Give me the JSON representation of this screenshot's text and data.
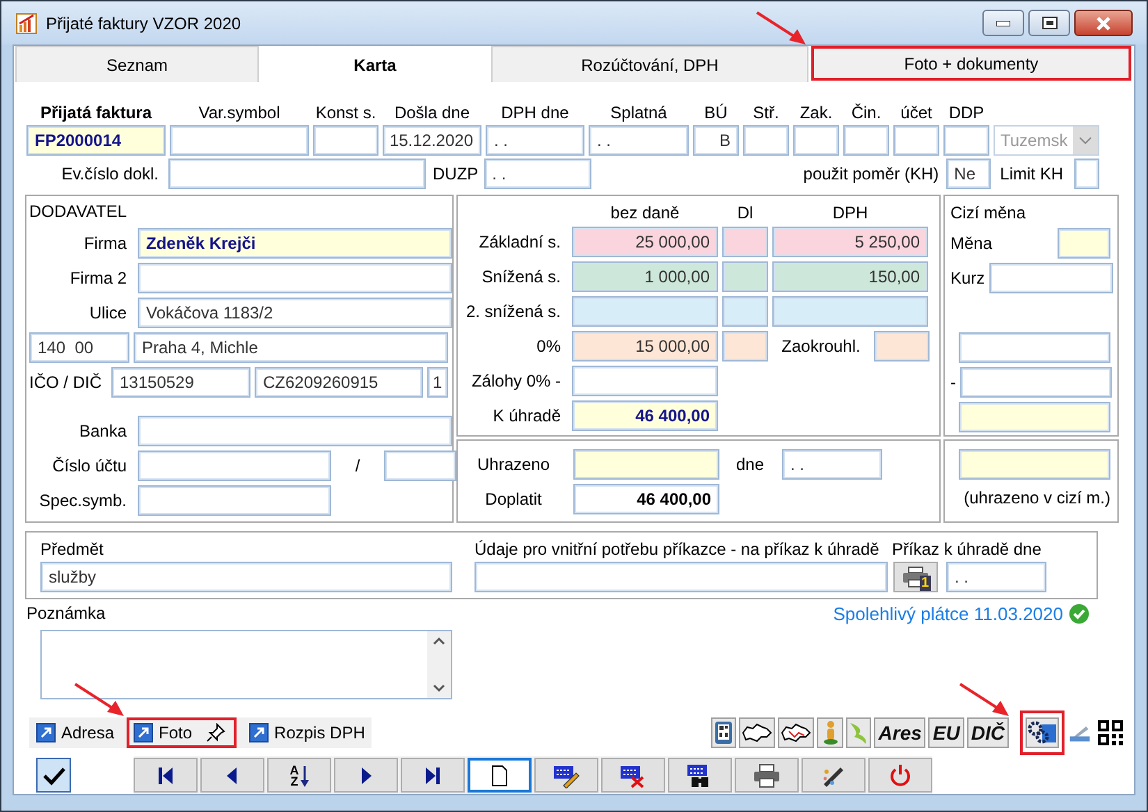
{
  "window": {
    "title": "Přijaté faktury VZOR 2020"
  },
  "tabs": [
    {
      "label": "Seznam",
      "selected": false,
      "highlighted": false
    },
    {
      "label": "Karta",
      "selected": true,
      "highlighted": false
    },
    {
      "label": "Rozúčtování, DPH",
      "selected": false,
      "highlighted": false
    },
    {
      "label": "Foto + dokumenty",
      "selected": false,
      "highlighted": true
    }
  ],
  "invoice": {
    "label": "Přijatá faktura",
    "number": "FP2000014"
  },
  "header_fields": [
    {
      "label": "Var.symbol"
    },
    {
      "label": "Konst s."
    },
    {
      "label": "Došla dne",
      "value": "15.12.2020"
    },
    {
      "label": "DPH dne",
      "value": ". ."
    },
    {
      "label": "Splatná",
      "value": ". ."
    },
    {
      "label": "BÚ",
      "value": "B"
    },
    {
      "label": "Stř."
    },
    {
      "label": "Zak."
    },
    {
      "label": "Čin."
    },
    {
      "label": "účet"
    },
    {
      "label": "DDP"
    }
  ],
  "type_select": {
    "value": "Tuzemsk",
    "disabled": true
  },
  "document_number": {
    "label": "Ev.číslo dokl."
  },
  "duzp": {
    "label": "DUZP",
    "value": ". ."
  },
  "kh_ratio": {
    "label": "použit poměr (KH)",
    "value": "Ne"
  },
  "limit_kh": {
    "label": "Limit KH"
  },
  "supplier": {
    "title": "DODAVATEL",
    "company": {
      "label": "Firma",
      "value": "Zdeněk Krejči"
    },
    "company_2": {
      "label": "Firma 2"
    },
    "street": {
      "label": "Ulice",
      "value": "Vokáčova 1183/2"
    },
    "zip": "140  00",
    "city": "Praha 4, Michle",
    "ids": {
      "label": "IČO / DIČ",
      "ico": "13150529",
      "dic": "CZ6209260915",
      "suffix": "1"
    },
    "bank": {
      "label": "Banka"
    },
    "account": {
      "label": "Číslo účtu",
      "separator": "/"
    },
    "spec_symbol": {
      "label": "Spec.symb."
    }
  },
  "amounts": {
    "columns": [
      "bez daně",
      "Dl",
      "DPH"
    ],
    "rows": [
      {
        "kind": "rate",
        "label": "Základní s.",
        "base": "25 000,00",
        "vat": "5 250,00",
        "color": "#fad5de"
      },
      {
        "kind": "rate",
        "label": "Snížená s.",
        "base": "1 000,00",
        "vat": "150,00",
        "color": "#cde7da"
      },
      {
        "kind": "rate",
        "label": "2. snížená s.",
        "color": "#d7edf8"
      },
      {
        "kind": "rounding",
        "label": "0%",
        "base": "15 000,00",
        "rounding_label": "Zaokrouhl.",
        "color": "#fde6d6"
      },
      {
        "kind": "advance",
        "label": "Zálohy 0% -"
      },
      {
        "kind": "total",
        "label": "K úhradě",
        "base": "46 400,00"
      }
    ]
  },
  "payment": {
    "paid_label": "Uhrazeno",
    "date_label": "dne",
    "date": ". .",
    "remaining_label": "Doplatit",
    "remaining": "46 400,00"
  },
  "foreign_currency": {
    "title": "Cizí měna",
    "currency_label": "Měna",
    "rate_label": "Kurz",
    "advance_sign": "-",
    "paid_note": "(uhrazeno v cizí m.)"
  },
  "subject": {
    "label": "Předmět",
    "value": "služby"
  },
  "internal": {
    "label": "Údaje pro vnitřní potřebu příkazce - na příkaz k úhradě"
  },
  "payment_order": {
    "label": "Příkaz k úhradě dne",
    "value": ". .",
    "print_badge": "1"
  },
  "note": {
    "label": "Poznámka"
  },
  "reliable_payer": {
    "text": "Spolehlivý plátce 11.03.2020",
    "verified": true
  },
  "links": [
    {
      "label": "Adresa",
      "pinned": false,
      "highlighted": false
    },
    {
      "label": "Foto",
      "pinned": true,
      "highlighted": true
    },
    {
      "label": "Rozpis DPH",
      "pinned": false,
      "highlighted": false
    }
  ],
  "tools": [
    {
      "kind": "qr-phone",
      "highlighted": false
    },
    {
      "kind": "map",
      "highlighted": false
    },
    {
      "kind": "map-route",
      "highlighted": false
    },
    {
      "kind": "person",
      "highlighted": false
    },
    {
      "kind": "swoosh",
      "highlighted": false
    },
    {
      "kind": "text",
      "label": "Ares",
      "highlighted": false
    },
    {
      "kind": "text",
      "label": "EU",
      "highlighted": false
    },
    {
      "kind": "text",
      "label": "DIČ",
      "highlighted": false
    },
    {
      "kind": "gears",
      "highlighted": true
    },
    {
      "kind": "scanner",
      "highlighted": false
    },
    {
      "kind": "qr",
      "highlighted": false
    }
  ],
  "nav": [
    {
      "kind": "first",
      "focused": false
    },
    {
      "kind": "prev",
      "focused": false
    },
    {
      "kind": "sort",
      "label_top": "A",
      "label_bottom": "Z",
      "focused": false
    },
    {
      "kind": "next",
      "focused": false
    },
    {
      "kind": "last",
      "focused": false
    },
    {
      "kind": "new",
      "focused": true
    },
    {
      "kind": "edit",
      "focused": false
    },
    {
      "kind": "delete",
      "focused": false
    },
    {
      "kind": "find",
      "focused": false
    },
    {
      "kind": "print",
      "focused": false
    },
    {
      "kind": "tools",
      "focused": false
    },
    {
      "kind": "power",
      "focused": false
    }
  ]
}
